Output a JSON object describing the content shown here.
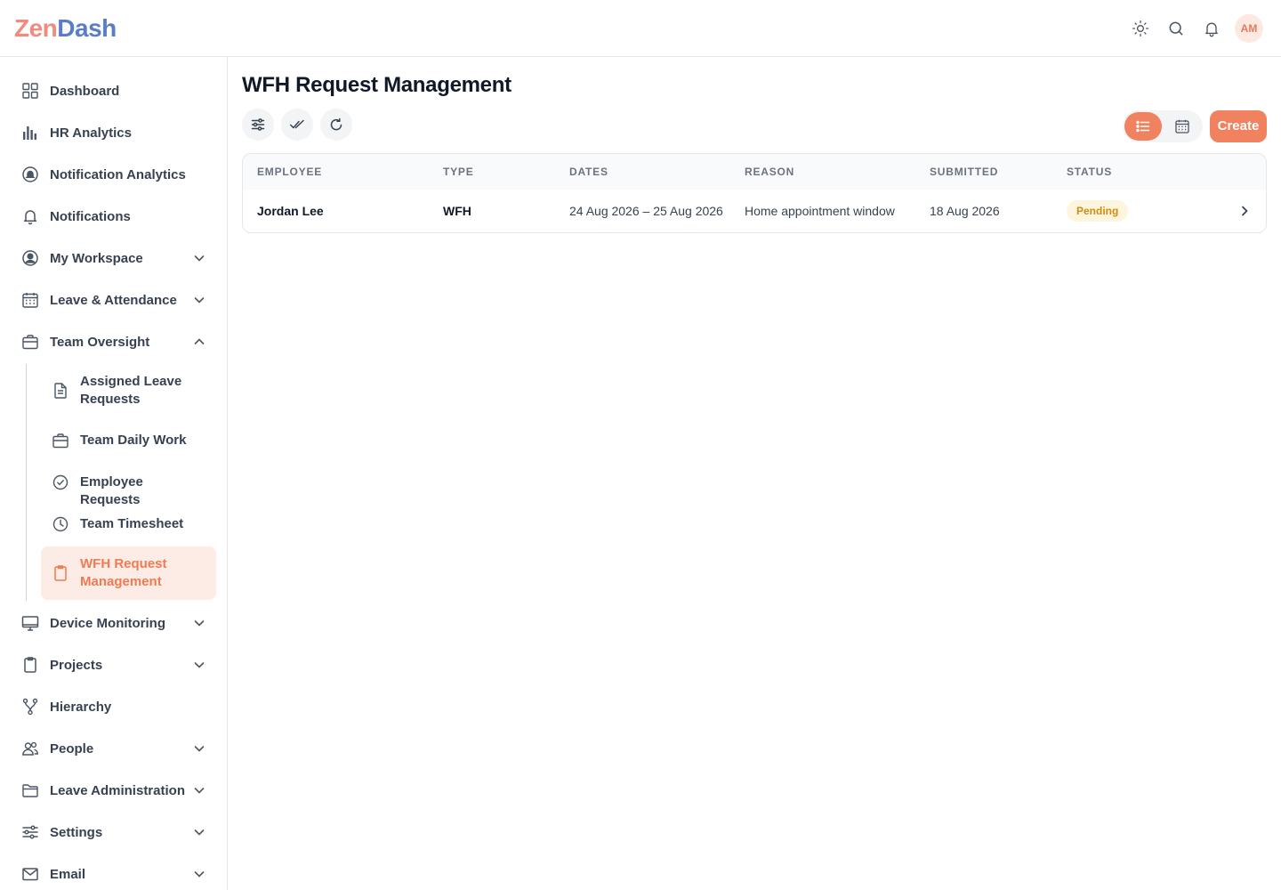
{
  "header": {
    "logo_part1": "Zen",
    "logo_part2": "Dash",
    "icons": [
      "sun-icon",
      "search-icon",
      "bell-icon"
    ],
    "avatar_initials": "AM"
  },
  "sidebar": {
    "items": [
      {
        "label": "Dashboard",
        "icon": "grid-icon"
      },
      {
        "label": "HR Analytics",
        "icon": "bar-chart-icon"
      },
      {
        "label": "Notification Analytics",
        "icon": "notification-analytics-icon"
      },
      {
        "label": "Notifications",
        "icon": "bell-icon"
      },
      {
        "label": "My Workspace",
        "icon": "user-circle-icon",
        "expandable": true
      },
      {
        "label": "Leave & Attendance",
        "icon": "calendar-icon",
        "expandable": true
      },
      {
        "label": "Team Oversight",
        "icon": "briefcase-icon",
        "expandable": true,
        "expanded": true
      },
      {
        "label": "Device Monitoring",
        "icon": "monitor-icon",
        "expandable": true
      },
      {
        "label": "Projects",
        "icon": "clipboard-icon",
        "expandable": true
      },
      {
        "label": "Hierarchy",
        "icon": "hierarchy-icon"
      },
      {
        "label": "People",
        "icon": "users-icon",
        "expandable": true
      },
      {
        "label": "Leave Administration",
        "icon": "folder-icon",
        "expandable": true
      },
      {
        "label": "Settings",
        "icon": "sliders-icon",
        "expandable": true
      },
      {
        "label": "Email",
        "icon": "mail-icon",
        "expandable": true
      }
    ],
    "team_oversight_items": [
      {
        "label": "Assigned Leave Requests",
        "icon": "document-icon"
      },
      {
        "label": "Team Daily Work",
        "icon": "briefcase-icon"
      },
      {
        "label": "Employee Requests",
        "icon": "check-circle-icon"
      },
      {
        "label": "Team Timesheet",
        "icon": "clock-icon"
      },
      {
        "label": "WFH Request Management",
        "icon": "clipboard-icon",
        "active": true
      }
    ]
  },
  "main": {
    "title": "WFH Request Management",
    "toolbar": {
      "filter_icon": "filter-sliders-icon",
      "approve_icon": "double-check-icon",
      "refresh_icon": "refresh-icon",
      "list_view_icon": "list-icon",
      "calendar_view_icon": "calendar-icon",
      "create_label": "Create"
    },
    "table": {
      "columns": [
        "EMPLOYEE",
        "TYPE",
        "DATES",
        "REASON",
        "SUBMITTED",
        "STATUS"
      ],
      "rows": [
        {
          "employee": "Jordan Lee",
          "type": "WFH",
          "dates": "24 Aug 2026 – 25 Aug 2026",
          "reason": "Home appointment window",
          "submitted": "18 Aug 2026",
          "status": "Pending"
        }
      ]
    }
  },
  "colors": {
    "accent": "#f0825f",
    "active_bg": "#fdece5",
    "pending_bg": "#fef6dc",
    "pending_text": "#d08b12"
  }
}
